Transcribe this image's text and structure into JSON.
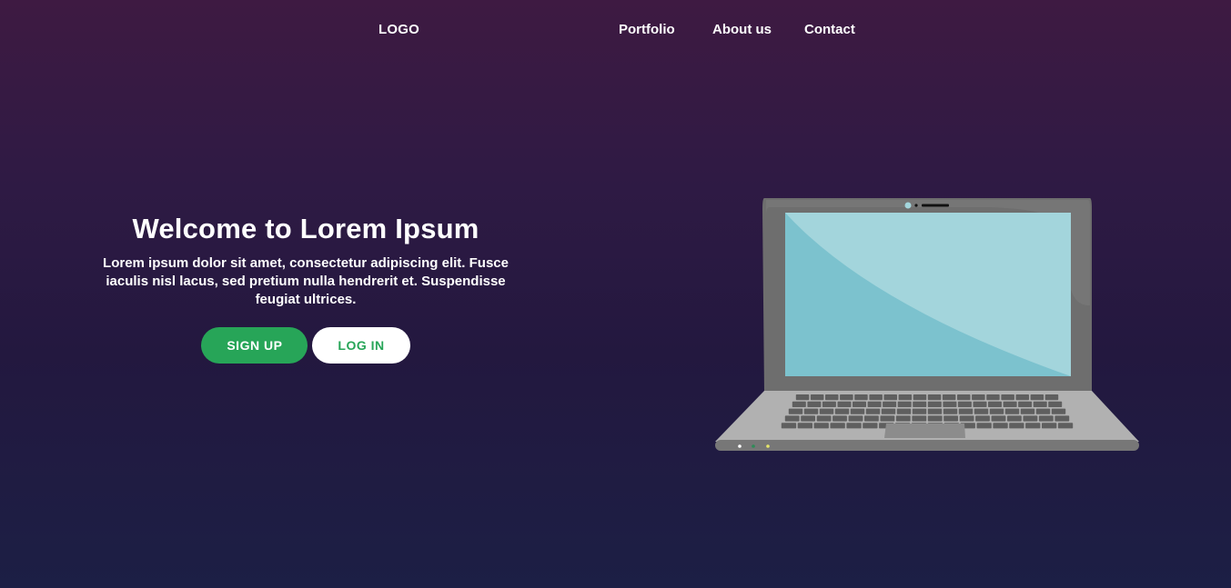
{
  "nav": {
    "logo": "LOGO",
    "links": [
      {
        "label": "Portfolio"
      },
      {
        "label": "About us"
      },
      {
        "label": "Contact"
      }
    ]
  },
  "hero": {
    "title": "Welcome to Lorem Ipsum",
    "text": "Lorem ipsum dolor sit amet, consectetur adipiscing elit. Fusce iaculis nisl lacus, sed pretium nulla hendrerit et. Suspendisse feugiat ultrices.",
    "signup_label": "SIGN UP",
    "login_label": "LOG IN"
  },
  "illustration": {
    "icon": "laptop-icon",
    "screen_color": "#a3d5dc",
    "screen_shade_color": "#7cc2ce",
    "body_color": "#6d6d6d",
    "base_color": "#b0b0b0",
    "key_color": "#5f5f5f"
  },
  "colors": {
    "accent": "#27a558",
    "background_top": "#3e1a42",
    "background_bottom": "#1c1f45"
  }
}
